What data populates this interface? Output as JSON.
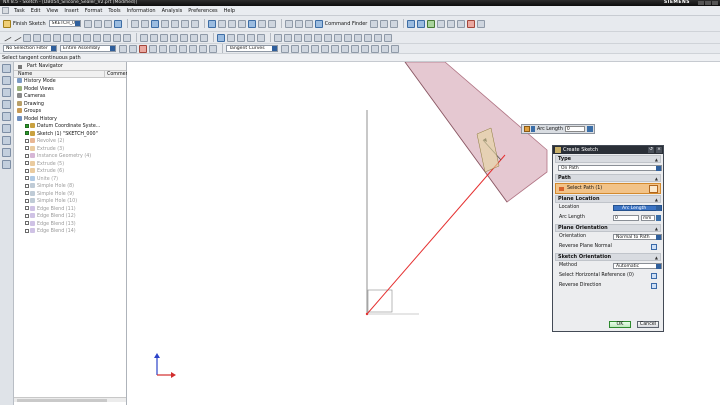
{
  "window": {
    "title": "NX 8.5 - Sketch - [DB054_Silicone_Sealer_V2.prt (Modified)]",
    "brand": "SIEMENS"
  },
  "menu": [
    "Task",
    "Edit",
    "View",
    "Insert",
    "Format",
    "Tools",
    "Information",
    "Analysis",
    "Preferences",
    "Help"
  ],
  "toolbar1": {
    "finish_sketch": "Finish Sketch",
    "sketch_name": "SKETCH_005",
    "command_finder": "Command Finder"
  },
  "toolbar3": {
    "selection_filter": "No Selection Filter",
    "assembly_scope": "Entire Assembly",
    "curve_rule": "Tangent Curves"
  },
  "cue_line": "Select tangent continuous path",
  "navigator": {
    "title": "Part Navigator",
    "columns": [
      "Name",
      "Comment"
    ],
    "items": [
      {
        "label": "History Mode",
        "icon": "history-mode-icon",
        "dim": false,
        "checked": false
      },
      {
        "label": "Model Views",
        "icon": "model-views-icon",
        "dim": false,
        "checked": false
      },
      {
        "label": "Cameras",
        "icon": "cameras-icon",
        "dim": false,
        "checked": false
      },
      {
        "label": "Drawing",
        "icon": "drawing-icon",
        "dim": false,
        "checked": false
      },
      {
        "label": "Groups",
        "icon": "groups-icon",
        "dim": false,
        "checked": false
      },
      {
        "label": "Model History",
        "icon": "model-history-icon",
        "dim": false,
        "checked": false
      },
      {
        "label": "Datum Coordinate Syste...",
        "icon": "datum-csys-icon",
        "dim": false,
        "checked": true
      },
      {
        "label": "Sketch (1) \"SKETCH_000\"",
        "icon": "sketch-icon",
        "dim": false,
        "checked": true
      },
      {
        "label": "Revolve (2)",
        "icon": "revolve-icon",
        "dim": true,
        "checked": false
      },
      {
        "label": "Extrude (3)",
        "icon": "extrude-icon",
        "dim": true,
        "checked": false
      },
      {
        "label": "Instance Geometry (4)",
        "icon": "instance-geometry-icon",
        "dim": true,
        "checked": false
      },
      {
        "label": "Extrude (5)",
        "icon": "extrude-icon",
        "dim": true,
        "checked": false
      },
      {
        "label": "Extrude (6)",
        "icon": "extrude-icon",
        "dim": true,
        "checked": false
      },
      {
        "label": "Unite (7)",
        "icon": "unite-icon",
        "dim": true,
        "checked": false
      },
      {
        "label": "Simple Hole (8)",
        "icon": "hole-icon",
        "dim": true,
        "checked": false
      },
      {
        "label": "Simple Hole (9)",
        "icon": "hole-icon",
        "dim": true,
        "checked": false
      },
      {
        "label": "Simple Hole (10)",
        "icon": "hole-icon",
        "dim": true,
        "checked": false
      },
      {
        "label": "Edge Blend (11)",
        "icon": "edge-blend-icon",
        "dim": true,
        "checked": false
      },
      {
        "label": "Edge Blend (12)",
        "icon": "edge-blend-icon",
        "dim": true,
        "checked": false
      },
      {
        "label": "Edge Blend (13)",
        "icon": "edge-blend-icon",
        "dim": true,
        "checked": false
      },
      {
        "label": "Edge Blend (14)",
        "icon": "edge-blend-icon",
        "dim": true,
        "checked": false
      }
    ]
  },
  "arc_length_popup": {
    "label": "Arc Length",
    "value": "0"
  },
  "dialog": {
    "title": "Create Sketch",
    "type_section": "Type",
    "type_value": "On Path",
    "path_section": "Path",
    "select_path": "Select Path (1)",
    "plane_location_section": "Plane Location",
    "location_label": "Location",
    "location_value": "Arc Length",
    "arc_length_label": "Arc Length",
    "arc_length_value": "0",
    "arc_length_unit": "mm",
    "plane_orientation_section": "Plane Orientation",
    "orientation_label": "Orientation",
    "orientation_value": "Normal to Path",
    "reverse_plane_normal": "Reverse Plane Normal",
    "sketch_orientation_section": "Sketch Orientation",
    "method_label": "Method",
    "method_value": "Automatic",
    "select_horizontal_ref": "Select Horizontal Reference (0)",
    "reverse_direction": "Reverse Direction",
    "ok": "OK",
    "cancel": "Cancel"
  },
  "colors": {
    "path_line": "#e53030",
    "plane_fill": "#dcb6c2",
    "plane_edge": "#b07484",
    "highlight": "#f2c388",
    "accent": "#3c74c4"
  }
}
